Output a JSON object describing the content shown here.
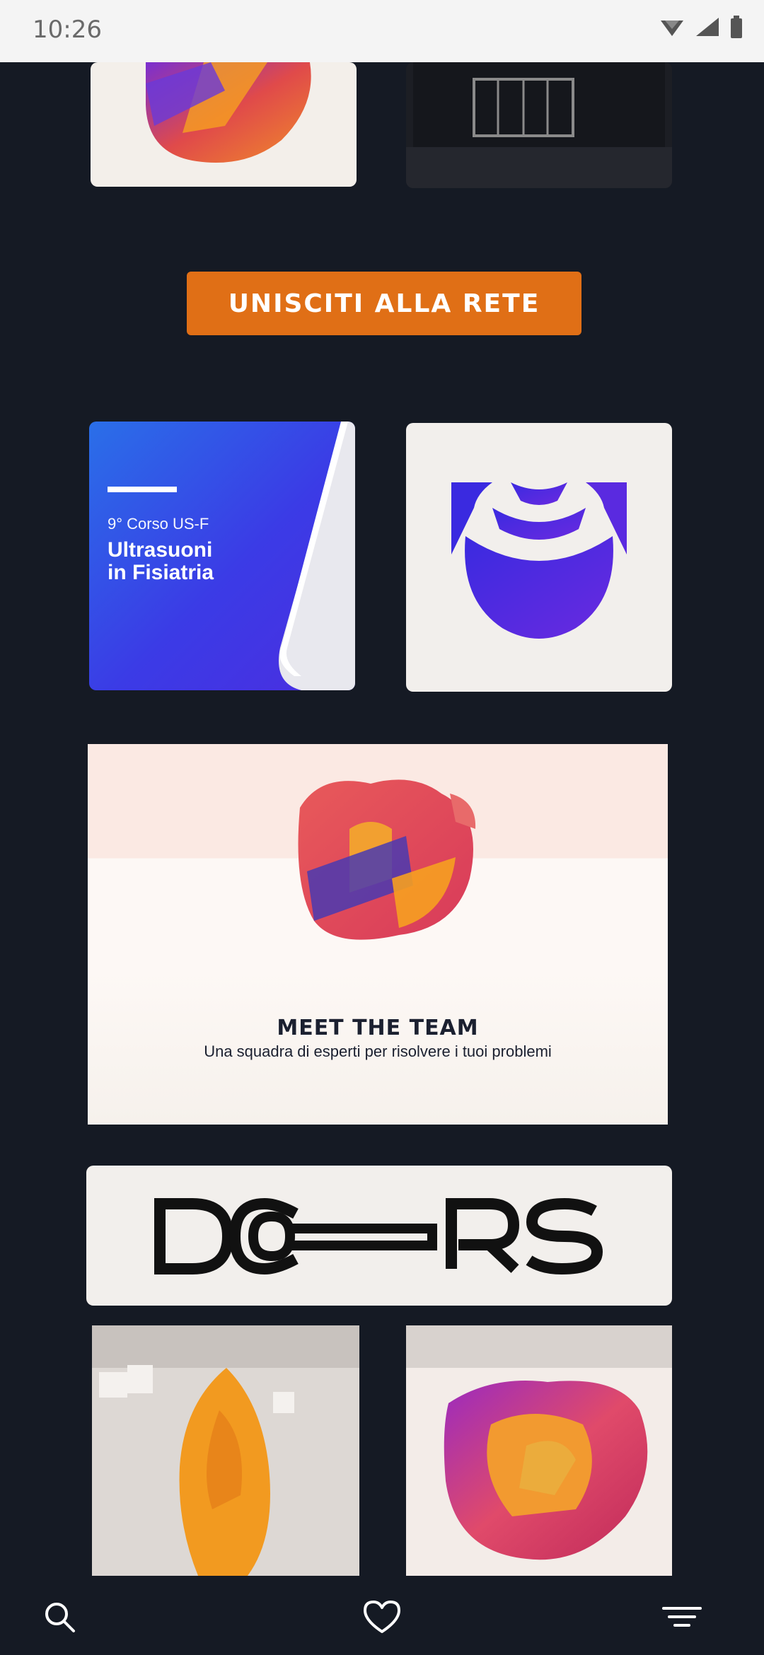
{
  "status": {
    "time": "10:26"
  },
  "cta": {
    "label": "UNISCITI ALLA RETE"
  },
  "course": {
    "subtitle": "9° Corso US-F",
    "title_line1": "Ultrasuoni",
    "title_line2": "in Fisiatria"
  },
  "team": {
    "title": "MEET THE TEAM",
    "subtitle": "Una squadra di esperti per risolvere i tuoi problemi"
  },
  "doors": {
    "logo_text": "DOORS"
  },
  "icons": {
    "search": "search-icon",
    "favorite": "heart-icon",
    "menu": "menu-icon"
  },
  "colors": {
    "accent": "#e06f16",
    "background": "#151a24",
    "brand_blue": "#4b2ee0"
  }
}
